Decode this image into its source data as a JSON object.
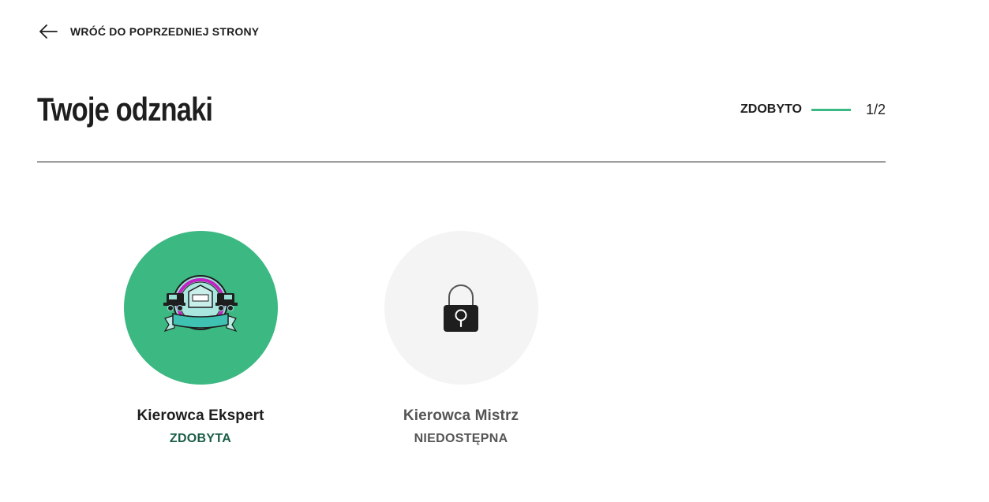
{
  "nav": {
    "back_label": "WRÓĆ DO POPRZEDNIEJ STRONY"
  },
  "header": {
    "title": "Twoje odznaki"
  },
  "progress": {
    "label": "ZDOBYTO",
    "count": "1/2",
    "earned": 1,
    "total": 2,
    "color": "#3cb882"
  },
  "badges": [
    {
      "name": "Kierowca Ekspert",
      "status": "ZDOBYTA",
      "earned": true,
      "icon": "truck-badge-icon",
      "circle_color": "#3cb882",
      "name_color": "#1e1e1e",
      "status_color": "#1b5e45"
    },
    {
      "name": "Kierowca Mistrz",
      "status": "NIEDOSTĘPNA",
      "earned": false,
      "icon": "lock-icon",
      "circle_color": "#f4f4f4",
      "name_color": "#555555",
      "status_color": "#555555"
    }
  ]
}
